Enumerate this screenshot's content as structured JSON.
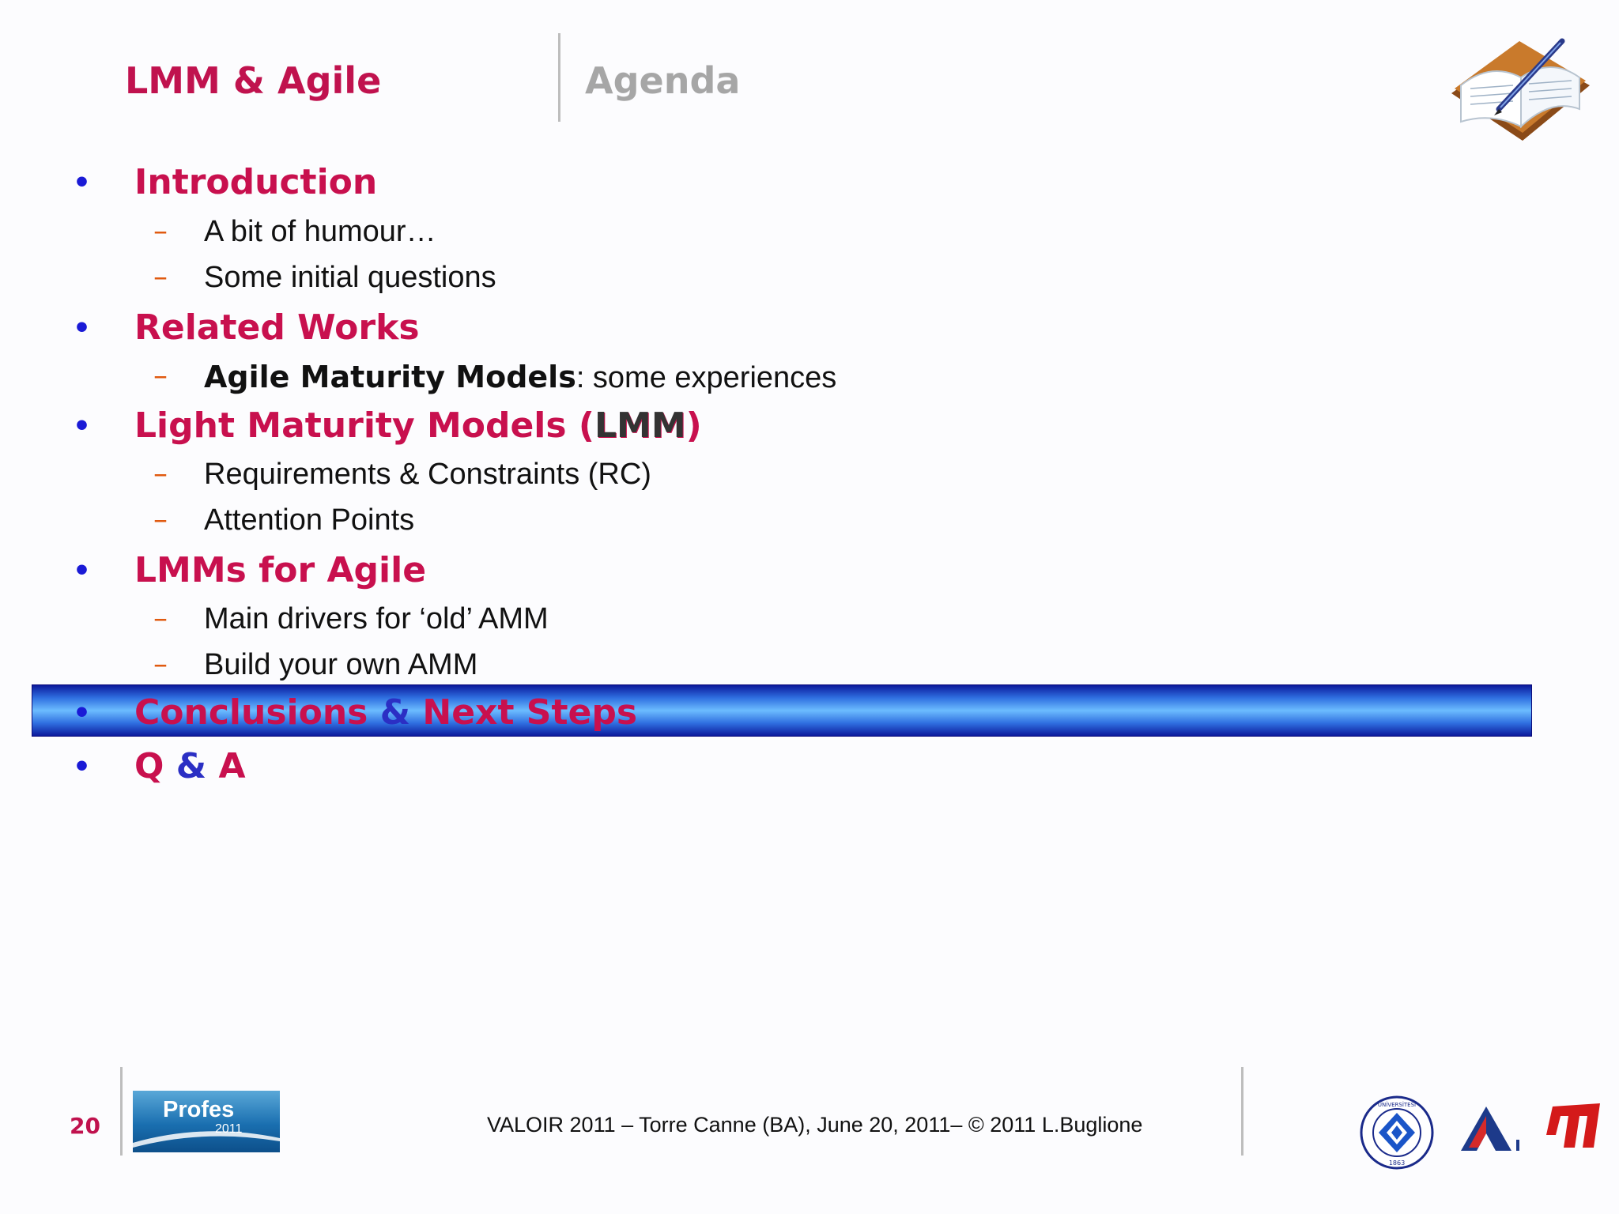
{
  "header": {
    "title": "LMM & Agile",
    "section": "Agenda"
  },
  "icons": {
    "book": "open-book-with-pen-icon"
  },
  "agenda": {
    "introduction": "Introduction",
    "intro_sub1": "A bit of humour…",
    "intro_sub2": "Some initial questions",
    "related_works": "Related Works",
    "related_sub1_bold": "Agile Maturity Models",
    "related_sub1_rest": ": some experiences",
    "lmm_title_prefix": "Light Maturity Models (",
    "lmm_title_abbr": "LMM",
    "lmm_title_suffix": ")",
    "lmm_sub1": "Requirements & Constraints (RC)",
    "lmm_sub2": "Attention Points",
    "lmms_agile": "LMMs for Agile",
    "agile_sub1": "Main drivers for ‘old’ AMM",
    "agile_sub2": "Build your own AMM",
    "conclusions_a": "Conclusions",
    "conclusions_amp": "&",
    "conclusions_b": "Next Steps",
    "qa_q": "Q",
    "qa_amp": "&",
    "qa_a": "A"
  },
  "bullets": {
    "level1": "•",
    "level2": "–"
  },
  "footer": {
    "page_number": "20",
    "profes_name": "Profes",
    "profes_year": "2011",
    "text": "VALOIR 2011 – Torre Canne (BA), June 20, 2011– © 2011 L.Buglione",
    "logo1_top": "BOĞAZİÇİ ÜNİVERSİTESİ",
    "logo1_year": "1863"
  },
  "colors": {
    "accent": "#c8104e",
    "bullet": "#1a1ad6",
    "dash": "#e05a10",
    "highlight_dark": "#0c1a9c",
    "highlight_light": "#6cbcff"
  }
}
